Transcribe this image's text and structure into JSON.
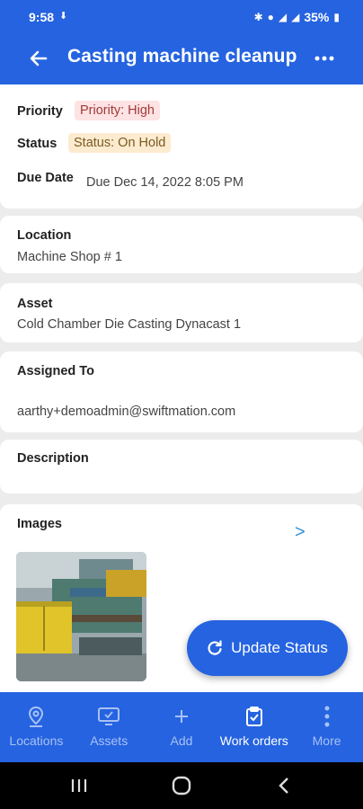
{
  "status_bar": {
    "time": "9:58",
    "battery": "35%"
  },
  "header": {
    "title": "Casting machine cleanup"
  },
  "details": {
    "priority_label": "Priority",
    "priority_value": "Priority: High",
    "status_label": "Status",
    "status_value": "Status: On Hold",
    "due_label": "Due Date",
    "due_value": "Due Dec 14, 2022 8:05 PM"
  },
  "location": {
    "label": "Location",
    "value": "Machine Shop # 1"
  },
  "asset": {
    "label": "Asset",
    "value": "Cold Chamber Die Casting Dynacast 1"
  },
  "assigned": {
    "label": "Assigned To",
    "value": "aarthy+demoadmin@swiftmation.com"
  },
  "description": {
    "label": "Description"
  },
  "images": {
    "label": "Images",
    "next": ">"
  },
  "fab": {
    "label": "Update Status"
  },
  "bottom_nav": [
    {
      "label": "Locations",
      "icon": "location-pin-icon"
    },
    {
      "label": "Assets",
      "icon": "monitor-icon"
    },
    {
      "label": "Add",
      "icon": "plus-icon"
    },
    {
      "label": "Work orders",
      "icon": "clipboard-check-icon",
      "active": true
    },
    {
      "label": "More",
      "icon": "vertical-dots-icon"
    }
  ],
  "colors": {
    "primary": "#2563e0",
    "priority_chip": "#fde3e4",
    "status_chip": "#fdebd0",
    "link": "#2d8fd5"
  }
}
